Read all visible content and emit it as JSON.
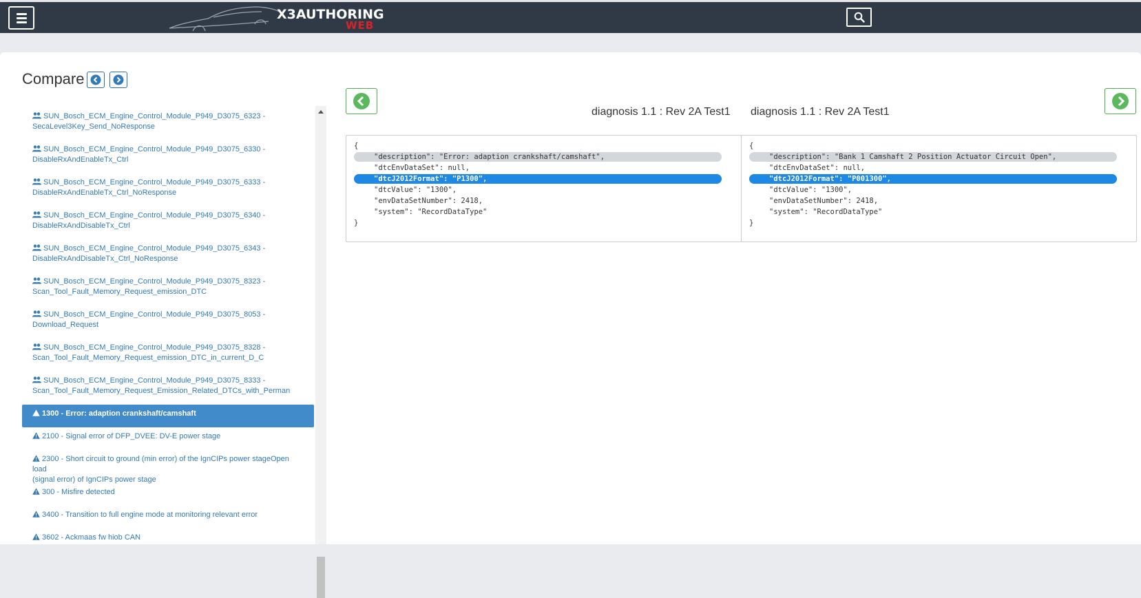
{
  "header": {
    "logo_line1": "X3AUTHORING",
    "logo_line2": "WEB",
    "menu_icon": "hamburger-icon",
    "search_icon": "search-icon"
  },
  "compare": {
    "title": "Compare",
    "prev_icon": "chevron-left-circle-icon",
    "next_icon": "chevron-right-circle-icon"
  },
  "list": {
    "tests": [
      {
        "line1": "SUN_Bosch_ECM_Engine_Control_Module_P949_D3075_6323 -",
        "line2": "SecaLevel3Key_Send_NoResponse"
      },
      {
        "line1": "SUN_Bosch_ECM_Engine_Control_Module_P949_D3075_6330 -",
        "line2": "DisableRxAndEnableTx_Ctrl"
      },
      {
        "line1": "SUN_Bosch_ECM_Engine_Control_Module_P949_D3075_6333 -",
        "line2": "DisableRxAndEnableTx_Ctrl_NoResponse"
      },
      {
        "line1": "SUN_Bosch_ECM_Engine_Control_Module_P949_D3075_6340 -",
        "line2": "DisableRxAndDisableTx_Ctrl"
      },
      {
        "line1": "SUN_Bosch_ECM_Engine_Control_Module_P949_D3075_6343 -",
        "line2": "DisableRxAndDisableTx_Ctrl_NoResponse"
      },
      {
        "line1": "SUN_Bosch_ECM_Engine_Control_Module_P949_D3075_8323 -",
        "line2": "Scan_Tool_Fault_Memory_Request_emission_DTC"
      },
      {
        "line1": "SUN_Bosch_ECM_Engine_Control_Module_P949_D3075_8053 -",
        "line2": "Download_Request"
      },
      {
        "line1": "SUN_Bosch_ECM_Engine_Control_Module_P949_D3075_8328 -",
        "line2": "Scan_Tool_Fault_Memory_Request_emission_DTC_in_current_D_C"
      },
      {
        "line1": "SUN_Bosch_ECM_Engine_Control_Module_P949_D3075_8333 -",
        "line2": "Scan_Tool_Fault_Memory_Request_Emission_Related_DTCs_with_Perman"
      }
    ],
    "dtcs": [
      {
        "text": "1300 - Error: adaption crankshaft/camshaft",
        "active": true
      },
      {
        "text": "2100 - Signal error of DFP_DVEE: DV-E power stage"
      },
      {
        "line1": "2300 - Short circuit to ground (min error) of the IgnCIPs power stageOpen load",
        "line2": "(signal error) of IgnCIPs power stage"
      },
      {
        "text": "300 - Misfire detected"
      },
      {
        "text": "3400 - Transition to full engine mode at monitoring relevant error"
      },
      {
        "text": "3602 - Ackmaas fw hiob CAN"
      }
    ],
    "test_icon": "users-icon",
    "dtc_icon": "warning-icon"
  },
  "left_pane": {
    "rev_label": "diagnosis 1.1 : Rev 2A Test1",
    "json": {
      "open": "{",
      "description": "\"description\": \"Error: adaption crankshaft/camshaft\",",
      "dtcEnvDataSet": "\"dtcEnvDataSet\": null,",
      "dtcJ2012Format": "\"dtcJ2012Format\": \"P1300\",",
      "dtcValue": "\"dtcValue\": \"1300\",",
      "envDataSetNumber": "\"envDataSetNumber\": 2418,",
      "system": "\"system\": \"RecordDataType\"",
      "close": "}"
    }
  },
  "right_pane": {
    "rev_label": "diagnosis 1.1 : Rev 2A Test1",
    "json": {
      "open": "{",
      "description": "\"description\": \"Bank 1 Camshaft 2 Position Actuator Circuit Open\",",
      "dtcEnvDataSet": "\"dtcEnvDataSet\": null,",
      "dtcJ2012Format": "\"dtcJ2012Format\": \"P001300\",",
      "dtcValue": "\"dtcValue\": \"1300\",",
      "envDataSetNumber": "\"envDataSetNumber\": 2418,",
      "system": "\"system\": \"RecordDataType\"",
      "close": "}"
    }
  },
  "colors": {
    "navbar": "#2f3a46",
    "link": "#337ab7",
    "active": "#428bca",
    "success": "#5cb85c",
    "diff_changed": "#1e88e5",
    "diff_grey": "#d3d7db",
    "logo_red": "#d8232a"
  }
}
